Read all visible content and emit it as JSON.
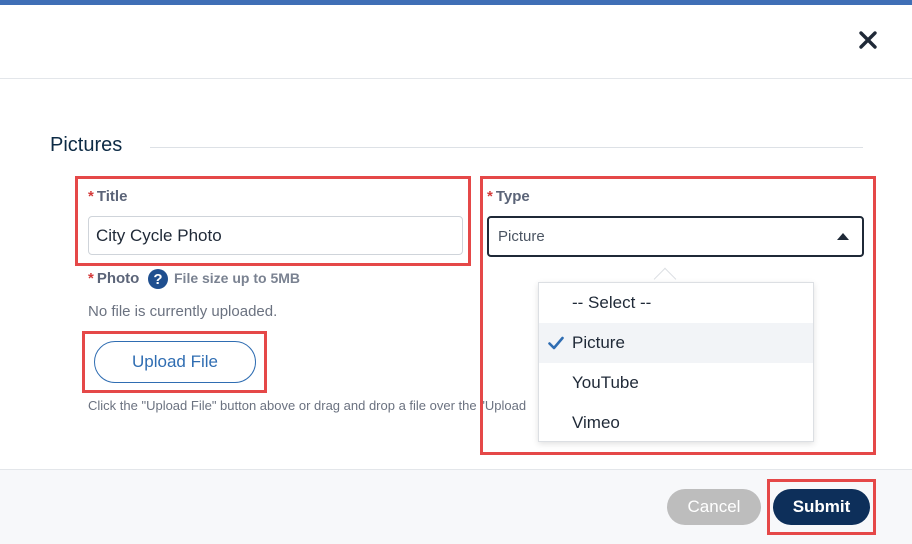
{
  "dialog": {
    "section_title": "Pictures",
    "close_icon": "close-icon"
  },
  "form": {
    "title_field": {
      "required_mark": "*",
      "label": "Title",
      "value": "City Cycle Photo"
    },
    "photo_field": {
      "required_mark": "*",
      "label": "Photo",
      "help_icon": "question-circle-icon",
      "help_glyph": "?",
      "size_hint": "File size up to 5MB",
      "no_file_text": "No file is currently uploaded.",
      "upload_button_label": "Upload File",
      "upload_hint": "Click the \"Upload File\" button above or drag and drop a file over the \"Upload"
    },
    "type_field": {
      "required_mark": "*",
      "label": "Type",
      "selected": "Picture",
      "options": [
        "-- Select --",
        "Picture",
        "YouTube",
        "Vimeo"
      ],
      "check_icon": "checkmark-icon"
    }
  },
  "footer": {
    "cancel_label": "Cancel",
    "submit_label": "Submit"
  },
  "colors": {
    "accent_bar": "#3f6fb6",
    "primary": "#0d2f5a",
    "link_blue": "#2f6db2",
    "highlight": "#e54848",
    "required": "#d43a3a"
  }
}
